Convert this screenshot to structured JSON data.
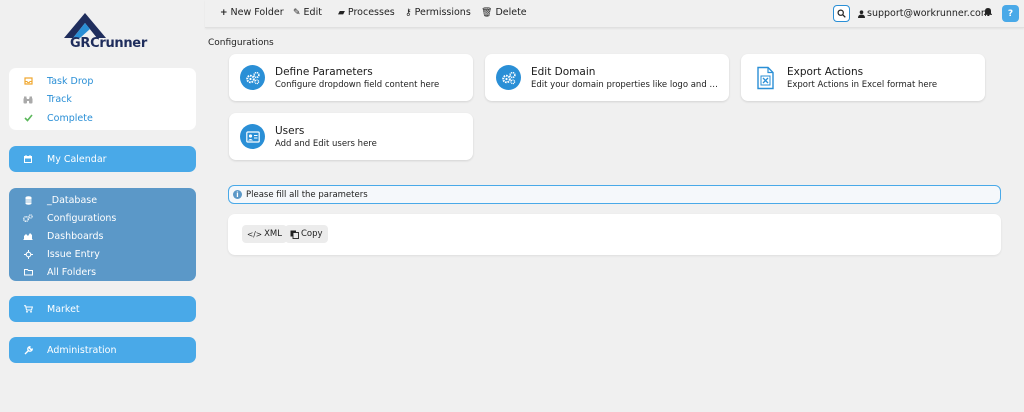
{
  "logo": {
    "text_a": "GRC",
    "text_b": "runner"
  },
  "sidebar": {
    "quick": [
      {
        "label": "Task Drop",
        "icon": "inbox-icon"
      },
      {
        "label": "Track",
        "icon": "binoculars-icon"
      },
      {
        "label": "Complete",
        "icon": "check-icon"
      }
    ],
    "calendar": {
      "label": "My Calendar",
      "icon": "calendar-icon"
    },
    "folders": [
      {
        "label": "_Database",
        "icon": "database-icon"
      },
      {
        "label": "Configurations",
        "icon": "gears-icon"
      },
      {
        "label": "Dashboards",
        "icon": "area-chart-icon"
      },
      {
        "label": "Issue Entry",
        "icon": "crosshair-icon"
      },
      {
        "label": "All Folders",
        "icon": "folder-icon"
      }
    ],
    "market": {
      "label": "Market",
      "icon": "cart-icon"
    },
    "administration": {
      "label": "Administration",
      "icon": "wrench-icon"
    }
  },
  "toolbar": {
    "new_folder": "New Folder",
    "edit": "Edit",
    "processes": "Processes",
    "permissions": "Permissions",
    "delete": "Delete",
    "email": "support@workrunner.com",
    "help": "?"
  },
  "breadcrumb": "Configurations",
  "cards": [
    {
      "title": "Define Parameters",
      "subtitle": "Configure dropdown field content here"
    },
    {
      "title": "Edit Domain",
      "subtitle": "Edit your domain properties like logo and o..."
    },
    {
      "title": "Export Actions",
      "subtitle": "Export Actions in Excel format here"
    },
    {
      "title": "Users",
      "subtitle": "Add and Edit users here"
    }
  ],
  "info": {
    "message": "Please fill all the parameters"
  },
  "actions": {
    "xml": "XML",
    "copy": "Copy"
  },
  "colors": {
    "accent": "#49a9e8",
    "accent_dark": "#2a8fd6",
    "folder_panel": "#5b98c8",
    "logo_navy": "#1f2d5c"
  }
}
